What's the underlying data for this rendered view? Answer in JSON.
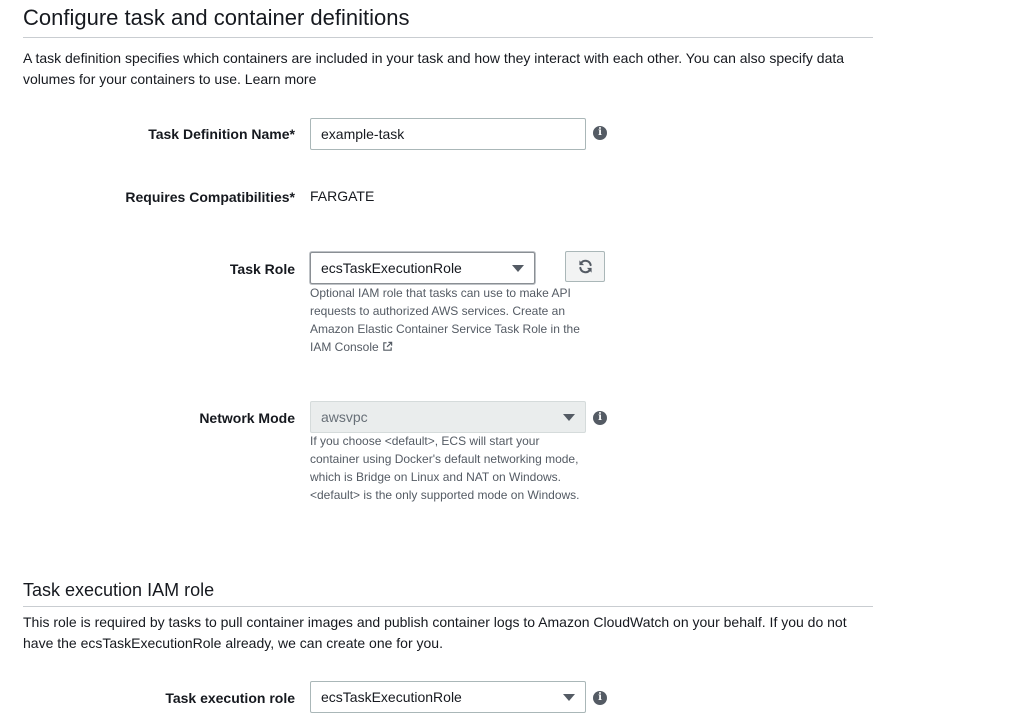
{
  "section1": {
    "title": "Configure task and container definitions",
    "description": "A task definition specifies which containers are included in your task and how they interact with each other. You can also specify data volumes for your containers to use.",
    "learn_more": "Learn more"
  },
  "task_definition_name": {
    "label": "Task Definition Name*",
    "value": "example-task"
  },
  "requires_compatibilities": {
    "label": "Requires Compatibilities*",
    "value": "FARGATE"
  },
  "task_role": {
    "label": "Task Role",
    "selected": "ecsTaskExecutionRole",
    "help": "Optional IAM role that tasks can use to make API requests to authorized AWS services. Create an Amazon Elastic Container Service Task Role in the",
    "help_link": "IAM Console"
  },
  "network_mode": {
    "label": "Network Mode",
    "selected": "awsvpc",
    "help": "If you choose <default>, ECS will start your container using Docker's default networking mode, which is Bridge on Linux and NAT on Windows. <default> is the only supported mode on Windows."
  },
  "section2": {
    "title": "Task execution IAM role",
    "description": "This role is required by tasks to pull container images and publish container logs to Amazon CloudWatch on your behalf. If you do not have the ecsTaskExecutionRole already, we can create one for you."
  },
  "task_execution_role": {
    "label": "Task execution role",
    "selected": "ecsTaskExecutionRole"
  },
  "icons": {
    "info": "info-icon",
    "refresh": "refresh-icon",
    "external_link": "external-link-icon",
    "dropdown": "chevron-down-icon"
  },
  "colors": {
    "text": "#16191f",
    "help_text": "#545b64",
    "border": "#aab7b8",
    "disabled_bg": "#eaeded"
  }
}
